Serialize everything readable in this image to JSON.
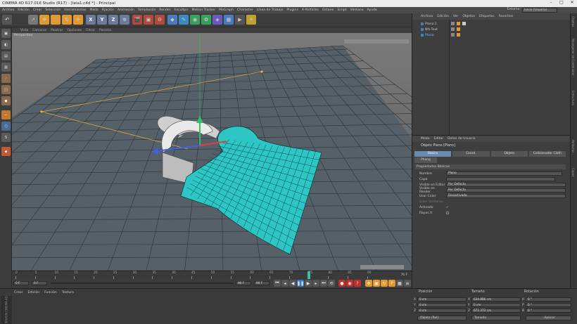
{
  "window": {
    "title": "CINEMA 4D R17.016 Studio (R17) - [tela1.c4d *] - Principal"
  },
  "menu": {
    "items": [
      "Archivo",
      "Edición",
      "Crear",
      "Selección",
      "Herramientas",
      "Malla",
      "Fijación",
      "Animación",
      "Simulación",
      "Render",
      "Escultpir",
      "Motion Tracker",
      "MoGraph",
      "Character",
      "Línea de Trabajo",
      "Plugins",
      "X-Particles",
      "Octane",
      "Script",
      "Ventana",
      "Ayuda"
    ],
    "layout_label": "Entorno:",
    "layout_value": "Inicio (Usuario)"
  },
  "toolbar": {
    "axis_x": "X",
    "axis_y": "Y",
    "axis_z": "Z"
  },
  "viewport": {
    "menu": [
      "Vista",
      "Cámaras",
      "Mostrar",
      "Opciones",
      "Filtrar",
      "Paneles"
    ],
    "label": "Perspectiva"
  },
  "timeline": {
    "ticks": [
      "0",
      "5",
      "10",
      "15",
      "20",
      "25",
      "30",
      "35",
      "40",
      "45",
      "50",
      "55",
      "60",
      "65",
      "70",
      "75",
      "80",
      "85",
      "90"
    ],
    "current_frame": "76 F",
    "start_field": "0 F",
    "end_field": "90 F",
    "min_field": "0 F",
    "max_field": "90 F"
  },
  "materials": {
    "menu": [
      "Crear",
      "Edición",
      "Función",
      "Textura"
    ],
    "brand": "MAXON CINEMA 4D"
  },
  "object_manager": {
    "menu": [
      "Archivo",
      "Edición",
      "Ver",
      "Objetos",
      "Etiquetas",
      "Favoritos"
    ],
    "objects": [
      {
        "name": "Plano.1",
        "color": "#b8b8b8"
      },
      {
        "name": "Nfs-Text",
        "color": "#b8b8b8"
      },
      {
        "name": "Plano",
        "color": "#7ab8ff"
      }
    ]
  },
  "attribute_manager": {
    "menu": [
      "Modo",
      "Editar",
      "Datos de Usuario"
    ],
    "object_title": "Objeto Plano [Plano]",
    "tabs": [
      "Básico",
      "Coord.",
      "Objeto",
      "Colisionador Cloth"
    ],
    "tab2": "Phong",
    "section": "Propiedades Básicas",
    "props": [
      {
        "label": "Nombre",
        "value": "Plano"
      },
      {
        "label": "Capa",
        "value": ""
      },
      {
        "label": "Visible en Editor",
        "value": "Por Defecto"
      },
      {
        "label": "Visible en Render",
        "value": "Por Defecto"
      },
      {
        "label": "Usar Color",
        "value": "Desactivado"
      },
      {
        "label": "Color Ventanas",
        "value": ""
      },
      {
        "label": "Activado",
        "value": "✓"
      },
      {
        "label": "Rayos X",
        "value": ""
      }
    ]
  },
  "right_strip": [
    "Objetos",
    "Navegador de Contenidos",
    "Estructura",
    "Atributos",
    "Capas"
  ],
  "coordinates": {
    "headers": {
      "position": "Posición",
      "size": "Tamaño",
      "rotation": "Rotación"
    },
    "rows": [
      {
        "axis": "X",
        "pos": "0 cm",
        "size_axis": "X",
        "size": "634.886 cm",
        "rot_axis": "H",
        "rot": "0 °"
      },
      {
        "axis": "Y",
        "pos": "0 cm",
        "size_axis": "Y",
        "size": "0 cm",
        "rot_axis": "P",
        "rot": "0 °"
      },
      {
        "axis": "Z",
        "pos": "0 cm",
        "size_axis": "Z",
        "size": "672.372 cm",
        "rot_axis": "B",
        "rot": "0 °"
      }
    ],
    "mode_select": "Objeto (Rel)",
    "size_select": "Tamaño",
    "apply_button": "Aplicar"
  }
}
